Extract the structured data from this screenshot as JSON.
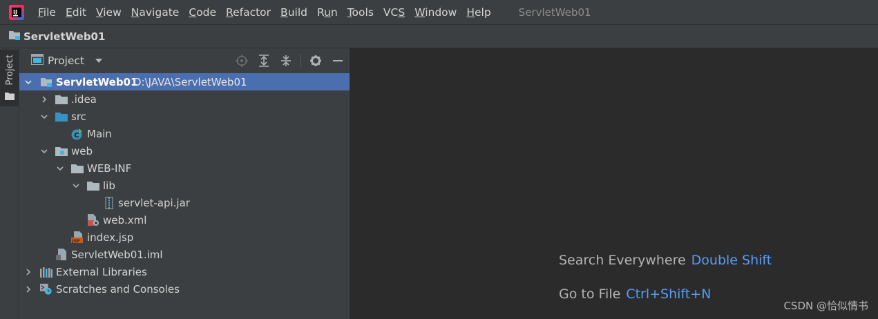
{
  "menubar": {
    "items": [
      {
        "prefix": "",
        "underline": "F",
        "rest": "ile"
      },
      {
        "prefix": "",
        "underline": "E",
        "rest": "dit"
      },
      {
        "prefix": "",
        "underline": "V",
        "rest": "iew"
      },
      {
        "prefix": "",
        "underline": "N",
        "rest": "avigate"
      },
      {
        "prefix": "",
        "underline": "C",
        "rest": "ode"
      },
      {
        "prefix": "",
        "underline": "R",
        "rest": "efactor"
      },
      {
        "prefix": "",
        "underline": "B",
        "rest": "uild"
      },
      {
        "prefix": "R",
        "underline": "u",
        "rest": "n"
      },
      {
        "prefix": "",
        "underline": "T",
        "rest": "ools"
      },
      {
        "prefix": "VC",
        "underline": "S",
        "rest": ""
      },
      {
        "prefix": "",
        "underline": "W",
        "rest": "indow"
      },
      {
        "prefix": "",
        "underline": "H",
        "rest": "elp"
      }
    ],
    "window_title": "ServletWeb01"
  },
  "navbar": {
    "crumb": "ServletWeb01"
  },
  "stripe": {
    "label": "Project"
  },
  "panel": {
    "title": "Project"
  },
  "tree": {
    "root_name": "ServletWeb01",
    "root_path": "D:\\JAVA\\ServletWeb01",
    "items": [
      {
        "label": ".idea"
      },
      {
        "label": "src"
      },
      {
        "label": "Main"
      },
      {
        "label": "web"
      },
      {
        "label": "WEB-INF"
      },
      {
        "label": "lib"
      },
      {
        "label": "servlet-api.jar"
      },
      {
        "label": "web.xml"
      },
      {
        "label": "index.jsp"
      },
      {
        "label": "ServletWeb01.iml"
      },
      {
        "label": "External Libraries"
      },
      {
        "label": "Scratches and Consoles"
      }
    ]
  },
  "editor": {
    "hints": [
      {
        "action": "Search Everywhere",
        "shortcut": "Double Shift"
      },
      {
        "action": "Go to File",
        "shortcut": "Ctrl+Shift+N"
      }
    ]
  },
  "watermark": "CSDN @恰似情书",
  "colors": {
    "selection": "#4b6eaf",
    "shortcut": "#589df6",
    "panel_bg": "#3c3f41",
    "editor_bg": "#2b2b2b"
  }
}
